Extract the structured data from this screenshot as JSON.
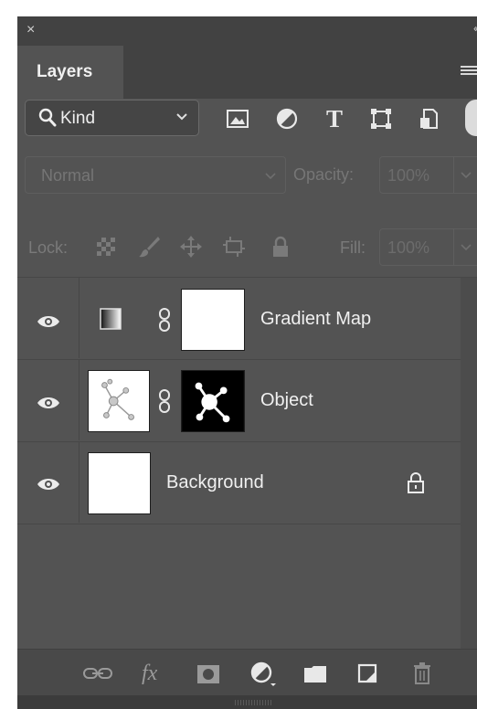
{
  "panel": {
    "close_glyph": "×",
    "collapse_glyph": "‹‹",
    "tab_label": "Layers",
    "colors": {
      "panel_bg": "#535353",
      "header_bg": "#424242",
      "text": "#f0f0f0"
    }
  },
  "filter": {
    "kind_label": "Kind",
    "icons": [
      "image-filter-icon",
      "adjustment-filter-icon",
      "type-filter-icon",
      "shape-filter-icon",
      "smart-object-filter-icon"
    ],
    "type_glyph": "T"
  },
  "blend": {
    "mode": "Normal",
    "opacity_label": "Opacity:",
    "opacity_value": "100%"
  },
  "lock": {
    "label": "Lock:",
    "fill_label": "Fill:",
    "fill_value": "100%"
  },
  "layers": [
    {
      "name": "Gradient Map",
      "visible": true,
      "type": "adjustment",
      "has_mask": true,
      "mask": "white"
    },
    {
      "name": "Object",
      "visible": true,
      "type": "pixel",
      "has_mask": true,
      "mask": "molecule-shape"
    },
    {
      "name": "Background",
      "visible": true,
      "type": "background",
      "locked": true
    }
  ],
  "bottom_bar": {
    "fx_label": "fx",
    "icons": [
      "link-layers-icon",
      "layer-style-icon",
      "add-mask-icon",
      "new-adjustment-icon",
      "new-group-icon",
      "new-layer-icon",
      "delete-layer-icon"
    ]
  }
}
